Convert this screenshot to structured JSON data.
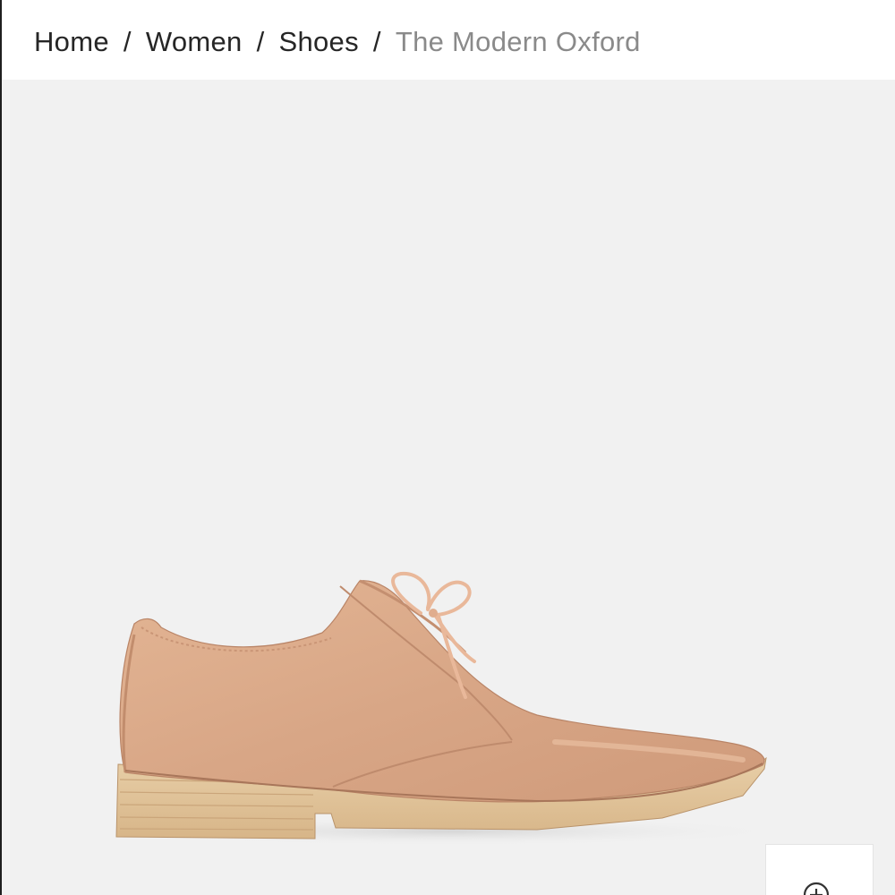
{
  "breadcrumb": {
    "items": [
      {
        "label": "Home"
      },
      {
        "label": "Women"
      },
      {
        "label": "Shoes"
      }
    ],
    "separator": "/",
    "current": "The Modern Oxford"
  },
  "product_image": {
    "subject": "shoe",
    "leather_color": "#d9a888",
    "sole_color": "#e2c49a",
    "background_color": "#f1f1f1"
  },
  "zoom": {
    "icon": "zoom-in-icon"
  }
}
